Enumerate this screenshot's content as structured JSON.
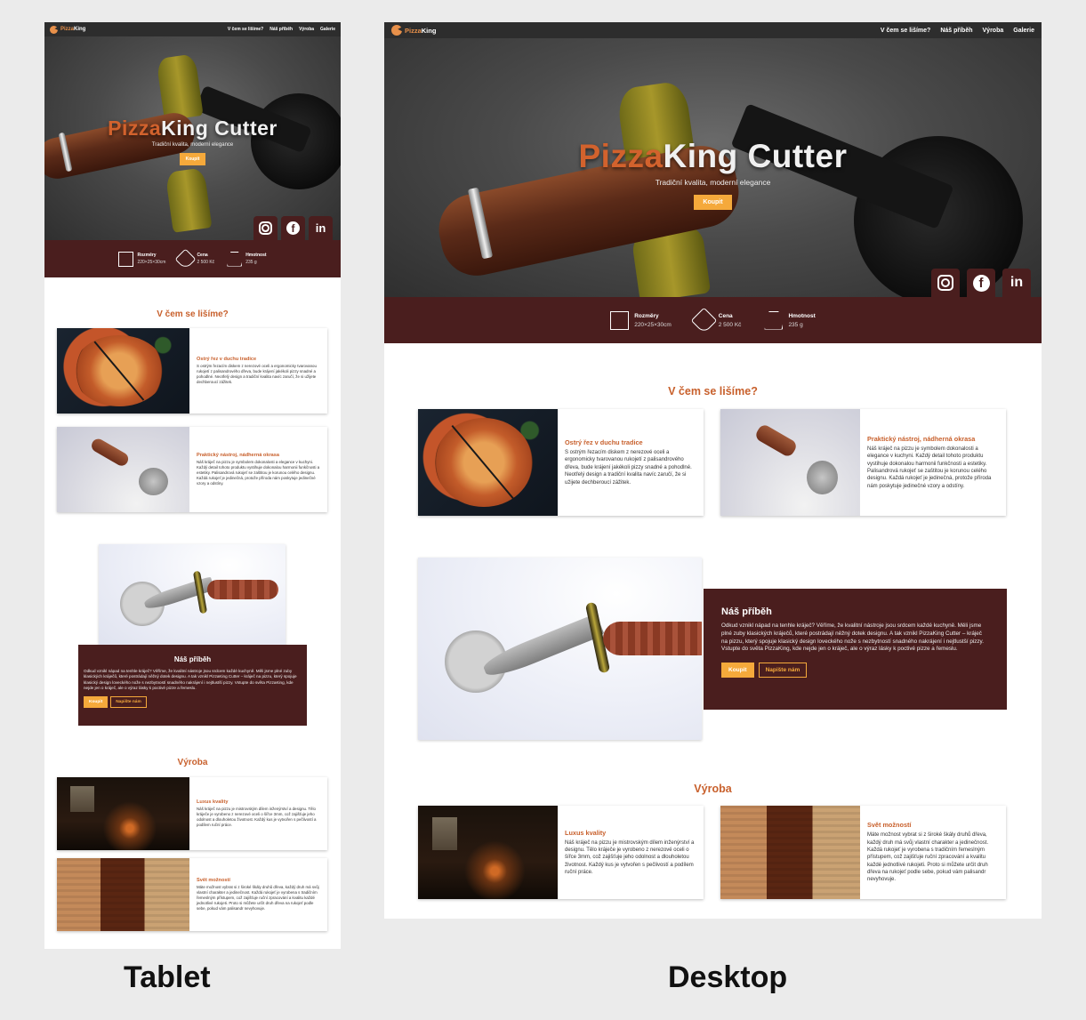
{
  "labels": {
    "tablet": "Tablet",
    "desktop": "Desktop"
  },
  "nav": {
    "brand_part1": "Pizza",
    "brand_part2": "King",
    "items": [
      "V čem se lišíme?",
      "Náš příběh",
      "Výroba",
      "Galerie"
    ]
  },
  "hero": {
    "title_part1": "Pizza",
    "title_part2": "King Cutter",
    "subtitle": "Tradiční kvalita, moderní elegance",
    "cta": "Koupit",
    "socials": {
      "instagram_icon": "instagram-icon",
      "facebook_icon": "facebook-icon",
      "linkedin": "in"
    }
  },
  "specs": [
    {
      "icon": "dimensions-icon",
      "label": "Rozměry",
      "value": "220×25×30cm"
    },
    {
      "icon": "price-tag-icon",
      "label": "Cena",
      "value": "2 500 Kč"
    },
    {
      "icon": "weight-icon",
      "label": "Hmotnost",
      "value": "235 g"
    }
  ],
  "differ": {
    "title": "V čem se lišíme?",
    "cards": [
      {
        "title": "Ostrý řez v duchu tradice",
        "text": "S ostrým řezacím diskem z nerezové oceli a ergonomicky tvarovanou rukojetí z palisandrového dřeva, bude krájení jakékoli pizzy snadné a pohodlné. Neotřelý design a tradiční kvalita navíc zaručí, že si užijete dechberoucí zážitek."
      },
      {
        "title": "Praktický nástroj, nádherná okrasa",
        "text": "Náš kráječ na pizzu je symbolem dokonalosti a elegance v kuchyni. Každý detail tohoto produktu vystihuje dokonalou harmonii funkčnosti a estetiky. Palisandrová rukojeť se zaštitou je korunou celého designu. Každá rukojeť je jedinečná, protože příroda nám poskytuje jedinečné vzory a odstíny."
      }
    ]
  },
  "story": {
    "title": "Náš příběh",
    "text": "Odkud vznikl nápad na tenhle kráječ? Věříme, že kvalitní nástroje jsou srdcem každé kuchyně. Měli jsme plné zuby klasických kráječů, které postrádají něžný dotek designu. A tak vznikl PizzaKing Cutter – kráječ na pizzu, který spojuje klasický design loveckého nože s nezbytností snadného nakrájení i nejtlustší pizzy. Vstupte do světa PizzaKing, kde nejde jen o kráječ, ale o výraz lásky k poctivé pizze a řemeslu.",
    "buy": "Koupit",
    "contact": "Napište nám"
  },
  "production": {
    "title": "Výroba",
    "cards": [
      {
        "title": "Luxus kvality",
        "text": "Náš kráječ na pizzu je mistrovským dílem inženýrství a designu. Tělo kráječe je vyrobeno z nerezové oceli o šířce 3mm, což zajišťuje jeho odolnost a dlouholetou životnost. Každý kus je vytvořen s pečlivostí a podílem ruční práce."
      },
      {
        "title": "Svět možností",
        "text": "Máte možnost vybrat si z široké škály druhů dřeva, každý druh má svůj vlastní charakter a jedinečnost. Každá rukojeť je vyrobena s tradičním řemeslným přístupem, což zajišťuje ruční zpracování a kvalitu každé jednotlivé rukojeti. Proto si můžete určit druh dřeva na rukojeť podle sebe, pokud vám palisandr nevyhovuje."
      }
    ]
  },
  "colors": {
    "accent": "#c8602c",
    "brand_dark": "#4a1e1e",
    "button": "#f5a93b",
    "nav": "#2d2d2d"
  }
}
